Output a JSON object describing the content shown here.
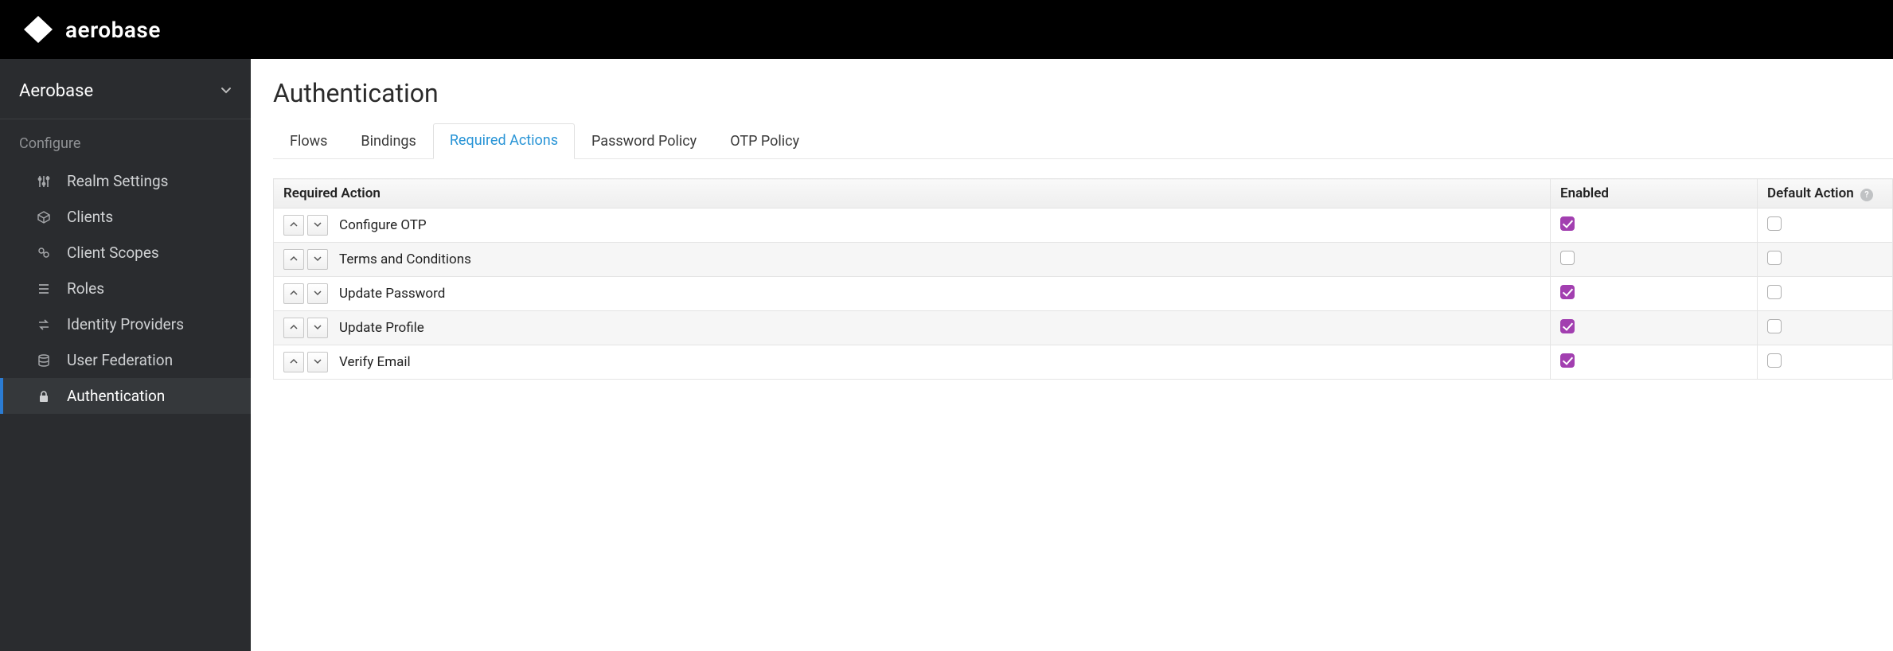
{
  "brand": {
    "name": "aerobase"
  },
  "realm_selector": {
    "label": "Aerobase"
  },
  "sidebar": {
    "section_label": "Configure",
    "items": [
      {
        "key": "realm-settings",
        "label": "Realm Settings",
        "icon": "sliders-icon"
      },
      {
        "key": "clients",
        "label": "Clients",
        "icon": "cube-icon"
      },
      {
        "key": "client-scopes",
        "label": "Client Scopes",
        "icon": "scope-icon"
      },
      {
        "key": "roles",
        "label": "Roles",
        "icon": "list-icon"
      },
      {
        "key": "identity-providers",
        "label": "Identity Providers",
        "icon": "exchange-icon"
      },
      {
        "key": "user-federation",
        "label": "User Federation",
        "icon": "database-icon"
      },
      {
        "key": "authentication",
        "label": "Authentication",
        "icon": "lock-icon"
      }
    ],
    "active_key": "authentication"
  },
  "page": {
    "title": "Authentication"
  },
  "tabs": {
    "items": [
      {
        "key": "flows",
        "label": "Flows"
      },
      {
        "key": "bindings",
        "label": "Bindings"
      },
      {
        "key": "required-actions",
        "label": "Required Actions"
      },
      {
        "key": "password-policy",
        "label": "Password Policy"
      },
      {
        "key": "otp-policy",
        "label": "OTP Policy"
      }
    ],
    "active_key": "required-actions"
  },
  "table": {
    "columns": {
      "required_action": "Required Action",
      "enabled": "Enabled",
      "default_action": "Default Action"
    },
    "rows": [
      {
        "name": "Configure OTP",
        "enabled": true,
        "default": false
      },
      {
        "name": "Terms and Conditions",
        "enabled": false,
        "default": false
      },
      {
        "name": "Update Password",
        "enabled": true,
        "default": false
      },
      {
        "name": "Update Profile",
        "enabled": true,
        "default": false
      },
      {
        "name": "Verify Email",
        "enabled": true,
        "default": false
      }
    ]
  },
  "icons": {
    "chevron_down": "chevron-down-icon",
    "chevron_up": "chevron-up-icon",
    "help": "help-icon"
  }
}
